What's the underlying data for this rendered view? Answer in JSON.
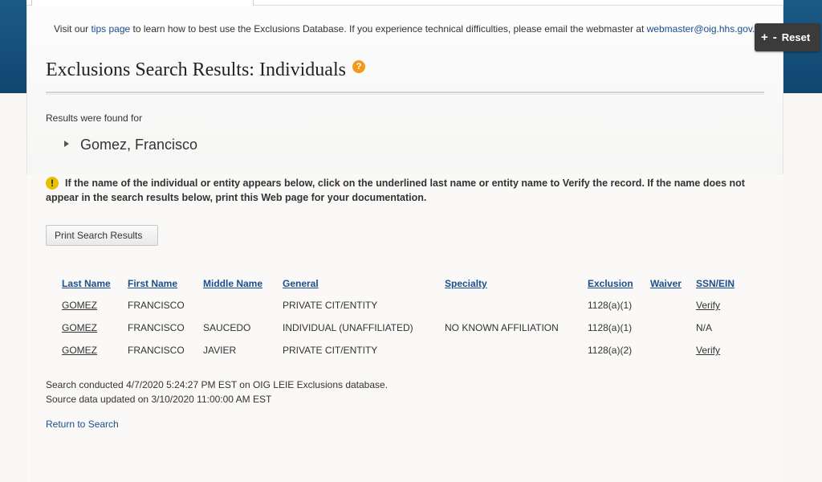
{
  "notice": {
    "prefix": "Visit our ",
    "tips_link": "tips page",
    "middle": " to learn how to best use the Exclusions Database. If you experience technical difficulties, please email the webmaster at ",
    "email_link": "webmaster@oig.hhs.gov."
  },
  "zoom": {
    "plus": "+",
    "minus": "-",
    "reset": "Reset"
  },
  "page_title": "Exclusions Search Results: Individuals",
  "help_icon_glyph": "?",
  "results_label": "Results were found for",
  "searched_name": "Gomez, Francisco",
  "warning_text": "If the name of the individual or entity appears below, click on the underlined last name or entity name to Verify the record. If the name does not appear in the search results below, print this Web page for your documentation.",
  "warning_icon_glyph": "!",
  "print_button": "Print Search Results",
  "table": {
    "headers": [
      "Last Name",
      "First Name",
      "Middle Name",
      "General",
      "Specialty",
      "Exclusion",
      "Waiver",
      "SSN/EIN"
    ],
    "rows": [
      [
        "GOMEZ",
        "FRANCISCO",
        "",
        "PRIVATE CIT/ENTITY",
        "",
        "1128(a)(1)",
        "",
        "Verify"
      ],
      [
        "GOMEZ",
        "FRANCISCO",
        "SAUCEDO",
        "INDIVIDUAL (UNAFFILIATED)",
        "NO KNOWN AFFILIATION",
        "1128(a)(1)",
        "",
        "N/A"
      ],
      [
        "GOMEZ",
        "FRANCISCO",
        "JAVIER",
        "PRIVATE CIT/ENTITY",
        "",
        "1128(a)(2)",
        "",
        "Verify"
      ]
    ]
  },
  "search_conducted": "Search conducted 4/7/2020 5:24:27 PM EST on OIG LEIE Exclusions database.",
  "source_updated": "Source data updated on 3/10/2020 11:00:00 AM EST",
  "return_link": "Return to Search",
  "colors": {
    "link": "#1a4e8c",
    "header_band": "#1c5a86",
    "help_icon": "#f39a1d",
    "warning_icon": "#e5c100"
  }
}
